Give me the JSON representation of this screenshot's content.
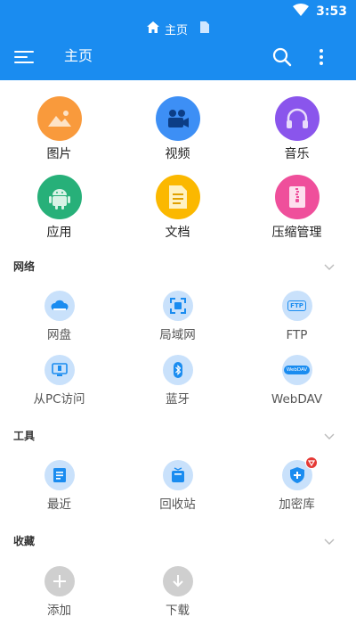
{
  "status_bar": {
    "time": "3:53",
    "icons": [
      "wifi-icon",
      "battery-icon"
    ]
  },
  "breadcrumb": {
    "icon": "home-icon",
    "label": "主页",
    "trailing_icon": "document-icon"
  },
  "app_bar": {
    "title": "主页",
    "menu_icon": "hamburger-icon",
    "search_icon": "search-icon",
    "more_icon": "more-vertical-icon"
  },
  "colors": {
    "primary": "#1a8cf0",
    "images": "#f99a3c",
    "video": "#3d8ff5",
    "music": "#8a55ec",
    "apps": "#27b079",
    "docs": "#fbb800",
    "archives": "#ef4f9b",
    "light_icon_bg": "#c9e1fb",
    "disabled_icon_bg": "#cfcfcf"
  },
  "categories": [
    {
      "label": "图片",
      "icon": "image-icon"
    },
    {
      "label": "视频",
      "icon": "video-icon"
    },
    {
      "label": "音乐",
      "icon": "headphones-icon"
    },
    {
      "label": "应用",
      "icon": "android-icon"
    },
    {
      "label": "文档",
      "icon": "document-icon"
    },
    {
      "label": "压缩管理",
      "icon": "archive-icon"
    }
  ],
  "sections": {
    "network": {
      "title": "网络",
      "items": [
        {
          "label": "网盘",
          "icon": "cloud-icon"
        },
        {
          "label": "局域网",
          "icon": "lan-icon"
        },
        {
          "label": "FTP",
          "icon": "ftp-icon",
          "icon_text": "FTP"
        },
        {
          "label": "从PC访问",
          "icon": "monitor-icon"
        },
        {
          "label": "蓝牙",
          "icon": "bluetooth-icon"
        },
        {
          "label": "WebDAV",
          "icon": "webdav-icon",
          "icon_text": "WebDAV"
        }
      ]
    },
    "tools": {
      "title": "工具",
      "items": [
        {
          "label": "最近",
          "icon": "recent-icon"
        },
        {
          "label": "回收站",
          "icon": "recycle-bin-icon"
        },
        {
          "label": "加密库",
          "icon": "shield-icon"
        }
      ]
    },
    "favorites": {
      "title": "收藏",
      "items": [
        {
          "label": "添加",
          "icon": "plus-icon"
        },
        {
          "label": "下载",
          "icon": "download-icon"
        }
      ]
    }
  }
}
